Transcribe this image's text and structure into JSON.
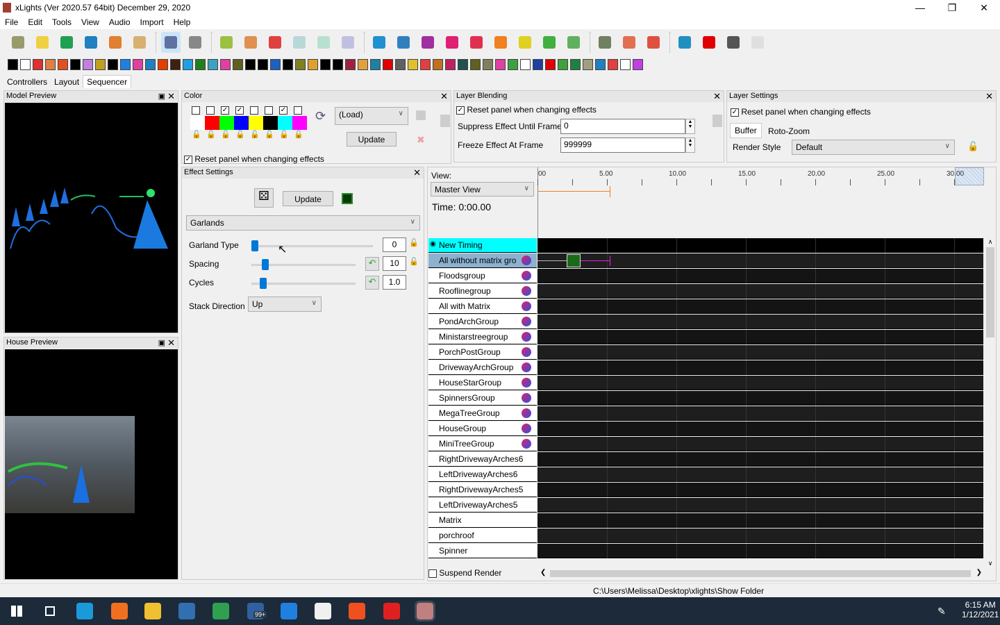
{
  "window": {
    "title": "xLights (Ver 2020.57 64bit) December 29, 2020",
    "minimize": "—",
    "maximize": "❐",
    "close": "✕"
  },
  "menu": [
    "File",
    "Edit",
    "Tools",
    "View",
    "Audio",
    "Import",
    "Help"
  ],
  "toolbar_icons": [
    {
      "name": "new-folder-icon",
      "color": "#9a9a6a"
    },
    {
      "name": "new-sequence-icon",
      "color": "#f0d040"
    },
    {
      "name": "open-icon",
      "color": "#20a050"
    },
    {
      "name": "save-icon",
      "color": "#2080c0"
    },
    {
      "name": "save-as-icon",
      "color": "#e08030"
    },
    {
      "name": "color-palette-icon",
      "color": "#d8b070"
    },
    {
      "name": "timer-icon",
      "color": "#6070a0"
    },
    {
      "name": "calculator-icon",
      "color": "#888888"
    },
    {
      "name": "play-icon",
      "color": "#9cc040"
    },
    {
      "name": "pause-icon",
      "color": "#e09050"
    },
    {
      "name": "stop-icon",
      "color": "#e04040"
    },
    {
      "name": "rewind-icon",
      "color": "#b8d8d8"
    },
    {
      "name": "forward-icon",
      "color": "#b8e0d0"
    },
    {
      "name": "replay-icon",
      "color": "#c0c0e0"
    },
    {
      "name": "gear-icon",
      "color": "#2090d0"
    },
    {
      "name": "crayons-icon",
      "color": "#3080c0"
    },
    {
      "name": "effects-icon",
      "color": "#a030a0"
    },
    {
      "name": "layers-icon",
      "color": "#e02070"
    },
    {
      "name": "model-icon",
      "color": "#e03050"
    },
    {
      "name": "house-icon",
      "color": "#f08020"
    },
    {
      "name": "tree-icon",
      "color": "#e0d020"
    },
    {
      "name": "spark-icon",
      "color": "#40b040"
    },
    {
      "name": "wand-icon",
      "color": "#60b060"
    },
    {
      "name": "zoom-in-icon",
      "color": "#708060"
    },
    {
      "name": "zoom-out-icon",
      "color": "#e07050"
    },
    {
      "name": "alert-icon",
      "color": "#e05040"
    },
    {
      "name": "help-icon",
      "color": "#2090c0"
    },
    {
      "name": "stop-sign-icon",
      "color": "#e00000"
    },
    {
      "name": "bulb-off-icon",
      "color": "#555555"
    },
    {
      "name": "bulb-on-icon",
      "color": "#e0e0e0"
    }
  ],
  "effect_colors": [
    "#000",
    "#fff",
    "#e03030",
    "#e08040",
    "#e05020",
    "#000",
    "#c080e0",
    "#c0a020",
    "#000",
    "#2080e0",
    "#e040a0",
    "#2080c0",
    "#e04000",
    "#402010",
    "#20a0e0",
    "#208020",
    "#40a0c0",
    "#e040a0",
    "#606020",
    "#000",
    "#000",
    "#2060c0",
    "#000",
    "#808020",
    "#e0a030",
    "#000",
    "#000",
    "#a02040",
    "#e0a040",
    "#2080a0",
    "#e00000",
    "#606060",
    "#e0c030",
    "#e04040",
    "#c07020",
    "#c02060",
    "#205050",
    "#606020",
    "#808060",
    "#e040a0",
    "#40a040",
    "#fff",
    "#2040a0",
    "#e00000",
    "#40a040",
    "#208040",
    "#a0a080",
    "#2080c0",
    "#e04040",
    "#fff",
    "#c040e0"
  ],
  "tabs": [
    "Controllers",
    "Layout",
    "Sequencer"
  ],
  "model_preview": {
    "title": "Model Preview"
  },
  "house_preview": {
    "title": "House Preview"
  },
  "color_panel": {
    "title": "Color",
    "checked": [
      false,
      false,
      true,
      true,
      false,
      false,
      true,
      false
    ],
    "swatches": [
      "#ffffff",
      "#ff0000",
      "#00ff00",
      "#0000ff",
      "#ffff00",
      "#000000",
      "#00ffff",
      "#ff00ff"
    ],
    "palette": "(Load)",
    "update": "Update",
    "reset": "Reset panel when changing effects"
  },
  "effect_settings": {
    "title": "Effect Settings",
    "update": "Update",
    "effect": "Garlands",
    "params": [
      {
        "label": "Garland Type",
        "value": "0",
        "level": 0
      },
      {
        "label": "Spacing",
        "value": "10",
        "level": 0.1
      },
      {
        "label": "Cycles",
        "value": "1.0",
        "level": 0.08
      }
    ],
    "stack_label": "Stack Direction",
    "stack_value": "Up"
  },
  "layer_blending": {
    "title": "Layer Blending",
    "reset": "Reset panel when changing effects",
    "suppress_label": "Suppress Effect Until Frame",
    "suppress_value": "0",
    "freeze_label": "Freeze Effect At Frame",
    "freeze_value": "999999"
  },
  "layer_settings": {
    "title": "Layer Settings",
    "reset": "Reset panel when changing effects",
    "tabs": [
      "Buffer",
      "Roto-Zoom"
    ],
    "render_style_label": "Render Style",
    "render_style": "Default"
  },
  "sequencer": {
    "view_label": "View:",
    "view": "Master View",
    "time": "Time: 0:00.00",
    "ticks": [
      "00",
      "5.00",
      "10.00",
      "15.00",
      "20.00",
      "25.00",
      "30.00"
    ],
    "rows": [
      "New Timing",
      "All without matrix gro",
      "Floodsgroup",
      "Rooflinegroup",
      "All with Matrix",
      "PondArchGroup",
      "Ministarstreegroup",
      "PorchPostGroup",
      "DrivewayArchGroup",
      "HouseStarGroup",
      "SpinnersGroup",
      "MegaTreeGroup",
      "HouseGroup",
      "MiniTreeGroup",
      "RightDrivewayArches6",
      "LeftDrivewayArches6",
      "RightDrivewayArches5",
      "LeftDrivewayArches5",
      "Matrix",
      "porchroof",
      "Spinner"
    ],
    "suspend": "Suspend Render"
  },
  "status": {
    "path": "C:\\Users\\Melissa\\Desktop\\xlights\\Show Folder"
  },
  "taskbar": {
    "time": "6:15 AM",
    "date": "1/12/2021",
    "mail_badge": "99+",
    "apps": [
      {
        "name": "start-icon",
        "color": "#ffffff"
      },
      {
        "name": "task-view-icon",
        "color": "#ffffff"
      },
      {
        "name": "edge-icon",
        "color": "#1a9ad8"
      },
      {
        "name": "firefox-icon",
        "color": "#f07020"
      },
      {
        "name": "file-explorer-icon",
        "color": "#f0c030"
      },
      {
        "name": "calculator-icon",
        "color": "#3070b0"
      },
      {
        "name": "chrome-icon",
        "color": "#30a050"
      },
      {
        "name": "mail-icon",
        "color": "#3060a0"
      },
      {
        "name": "signal-icon",
        "color": "#2080e0"
      },
      {
        "name": "store-icon",
        "color": "#f0f0f0"
      },
      {
        "name": "brave-icon",
        "color": "#f05020"
      },
      {
        "name": "recorder-icon",
        "color": "#e02020"
      },
      {
        "name": "xlights-icon",
        "color": "#c08080"
      }
    ]
  }
}
